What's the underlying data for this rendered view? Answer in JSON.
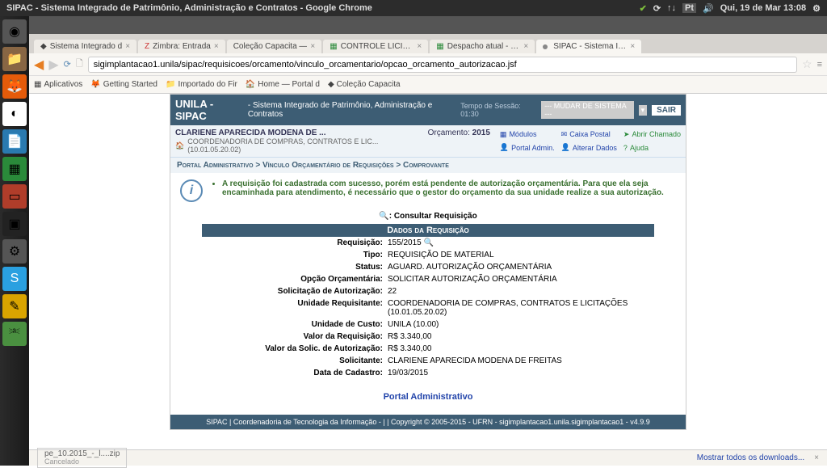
{
  "os": {
    "title": "SIPAC - Sistema Integrado de Patrimônio, Administração e Contratos - Google Chrome",
    "clock": "Qui, 19 de Mar 13:08",
    "lang": "Pt"
  },
  "tabs": [
    {
      "label": "Sistema Integrado d"
    },
    {
      "label": "Zimbra: Entrada"
    },
    {
      "label": "Coleção Capacita —"
    },
    {
      "label": "CONTROLE LICITAÇ"
    },
    {
      "label": "Despacho atual - Pla"
    },
    {
      "label": "SIPAC - Sistema Inte"
    }
  ],
  "url": "sigimplantacao1.unila/sipac/requisicoes/orcamento/vinculo_orcamentario/opcao_orcamento_autorizacao.jsf",
  "bookmarks": [
    "Aplicativos",
    "Getting Started",
    "Importado do Fir",
    "Home — Portal d",
    "Coleção Capacita"
  ],
  "sys": {
    "brand": "UNILA - SIPAC",
    "sub": "- Sistema Integrado de Patrimônio, Administração e Contratos",
    "session": "Tempo de Sessão: 01:30",
    "change_sys": "--- MUDAR DE SISTEMA ---",
    "logout": "SAIR",
    "user": "CLARIENE APARECIDA MODENA DE ...",
    "dept": "COORDENADORIA DE COMPRAS, CONTRATOS E LIC... (10.01.05.20.02)",
    "orc_label": "Orçamento:",
    "orc_year": "2015",
    "menus": [
      "Módulos",
      "Caixa Postal",
      "Abrir Chamado",
      "Portal Admin.",
      "Alterar Dados",
      "Ajuda"
    ],
    "breadcrumb": "Portal Administrativo > Vínculo Orçamentário de Requisições > Comprovante",
    "message": "A requisição foi cadastrada com sucesso, porém está pendente de autorização orçamentária. Para que ela seja encaminhada para atendimento, é necessário que o gestor do orçamento da sua unidade realize a sua autorização.",
    "consult": ": Consultar Requisição",
    "section": "Dados da Requisição",
    "fields": [
      {
        "k": "Requisição:",
        "v": "155/2015",
        "mag": true
      },
      {
        "k": "Tipo:",
        "v": "REQUISIÇÃO DE MATERIAL"
      },
      {
        "k": "Status:",
        "v": "AGUARD. AUTORIZAÇÃO ORÇAMENTÁRIA"
      },
      {
        "k": "Opção Orçamentária:",
        "v": "SOLICITAR AUTORIZAÇÃO ORÇAMENTÁRIA"
      },
      {
        "k": "Solicitação de Autorização:",
        "v": "22"
      },
      {
        "k": "Unidade Requisitante:",
        "v": "COORDENADORIA DE COMPRAS, CONTRATOS E LICITAÇÕES (10.01.05.20.02)"
      },
      {
        "k": "Unidade de Custo:",
        "v": "UNILA (10.00)"
      },
      {
        "k": "Valor da Requisição:",
        "v": "R$ 3.340,00"
      },
      {
        "k": "Valor da Solic. de Autorização:",
        "v": "R$ 3.340,00"
      },
      {
        "k": "Solicitante:",
        "v": "CLARIENE APARECIDA MODENA DE FREITAS"
      },
      {
        "k": "Data de Cadastro:",
        "v": "19/03/2015"
      }
    ],
    "portal_link": "Portal Administrativo",
    "footer": "SIPAC | Coordenadoria de Tecnologia da Informação - | | Copyright © 2005-2015 - UFRN - sigimplantacao1.unila.sigimplantacao1 - v4.9.9"
  },
  "download": {
    "file": "pe_10.2015_-_l....zip",
    "status": "Cancelado",
    "all": "Mostrar todos os downloads..."
  }
}
